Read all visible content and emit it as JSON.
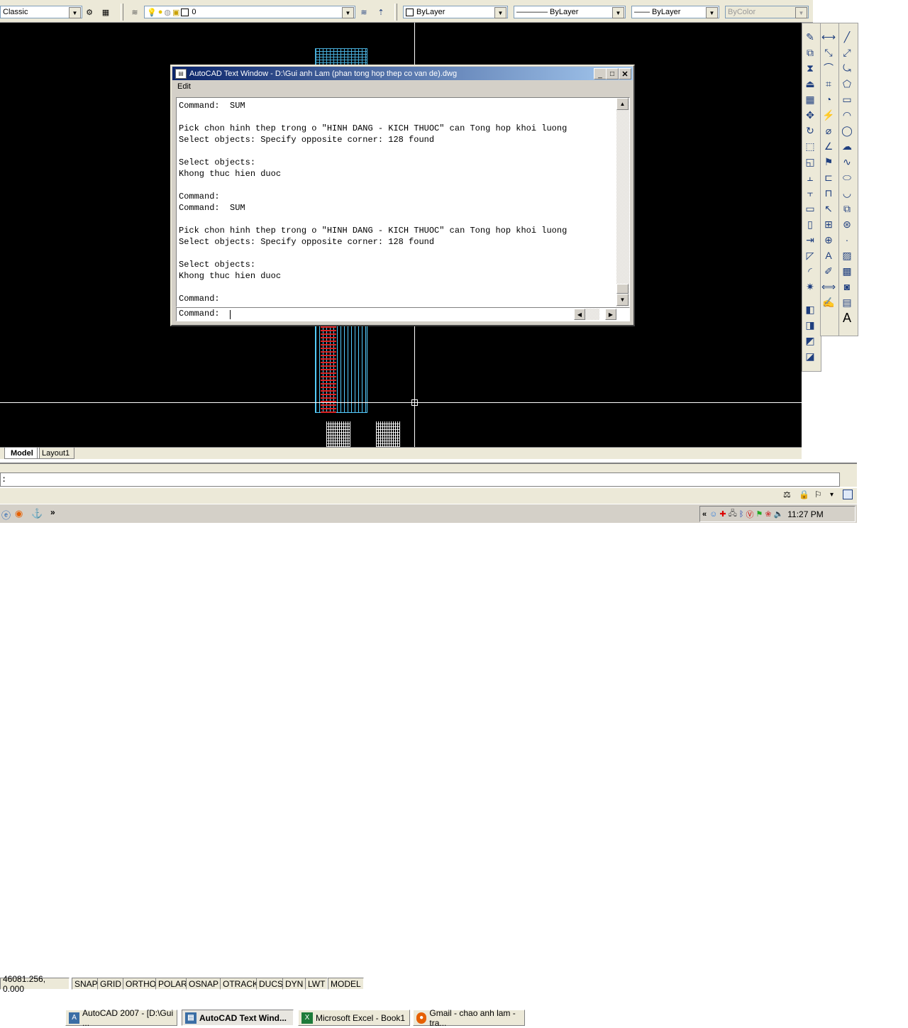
{
  "toolbar": {
    "workspace": "Classic",
    "layer": "0",
    "color": "ByLayer",
    "linetype": "———— ByLayer",
    "lineweight": "—— ByLayer",
    "plotstyle": "ByColor"
  },
  "drawing_tabs": [
    "Model",
    "Layout1"
  ],
  "command_line_prompt": ":",
  "statusbar": {
    "coords": "46081.256, 0.000",
    "toggles": [
      "SNAP",
      "GRID",
      "ORTHO",
      "POLAR",
      "OSNAP",
      "OTRACK",
      "DUCS",
      "DYN",
      "LWT",
      "MODEL"
    ]
  },
  "text_window": {
    "title": "AutoCAD Text Window - D:\\Gui anh Lam (phan tong hop thep co van de).dwg",
    "menu": "Edit",
    "lines": [
      "Command:  SUM",
      "",
      "Pick chon hinh thep trong o \"HINH DANG - KICH THUOC\" can Tong hop khoi luong",
      "Select objects: Specify opposite corner: 128 found",
      "",
      "Select objects:",
      "Khong thuc hien duoc",
      "",
      "Command:",
      "Command:  SUM",
      "",
      "Pick chon hinh thep trong o \"HINH DANG - KICH THUOC\" can Tong hop khoi luong",
      "Select objects: Specify opposite corner: 128 found",
      "",
      "Select objects:",
      "Khong thuc hien duoc",
      "",
      "Command:"
    ],
    "input_prompt": "Command:"
  },
  "taskbar": {
    "quick_more": "»",
    "tasks": [
      {
        "label": "AutoCAD 2007 - [D:\\Gui ...",
        "color": "#3a6ea5"
      },
      {
        "label": "AutoCAD Text Wind...",
        "color": "#3a6ea5"
      },
      {
        "label": "Microsoft Excel - Book1",
        "color": "#1e7b3a"
      },
      {
        "label": "Gmail - chao anh lam - tra...",
        "color": "#e66000"
      }
    ],
    "tray_more": "«",
    "clock": "11:27 PM"
  },
  "colors": {
    "drawing_bg": "#000000",
    "titlebar": "#0a246a",
    "titlebar_end": "#a6caf0",
    "chrome": "#ece9d8"
  }
}
